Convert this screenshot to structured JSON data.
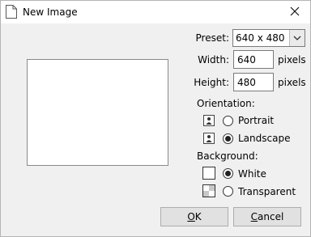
{
  "window": {
    "title": "New Image"
  },
  "preset": {
    "label": "Preset:",
    "value": "640 x 480"
  },
  "width": {
    "label": "Width:",
    "value": "640",
    "unit": "pixels"
  },
  "height": {
    "label": "Height:",
    "value": "480",
    "unit": "pixels"
  },
  "orientation": {
    "label": "Orientation:",
    "options": [
      {
        "label": "Portrait",
        "selected": false
      },
      {
        "label": "Landscape",
        "selected": true
      }
    ]
  },
  "background": {
    "label": "Background:",
    "options": [
      {
        "label": "White",
        "selected": true
      },
      {
        "label": "Transparent",
        "selected": false
      }
    ]
  },
  "buttons": {
    "ok": {
      "mnemonic": "O",
      "rest": "K"
    },
    "cancel": {
      "mnemonic": "C",
      "rest": "ancel"
    }
  },
  "icons": {
    "doc": "document-icon",
    "close": "close-icon",
    "dropdown": "chevron-down-icon",
    "portrait": "portrait-orientation-icon",
    "landscape": "landscape-orientation-icon"
  }
}
